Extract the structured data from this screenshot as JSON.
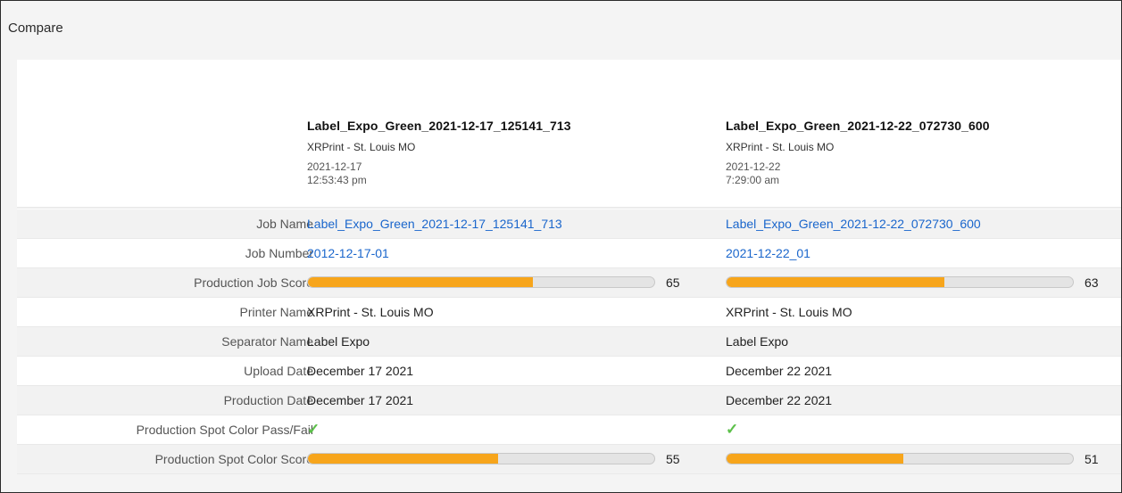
{
  "window": {
    "title": "Compare"
  },
  "jobs": [
    {
      "name": "Label_Expo_Green_2021-12-17_125141_713",
      "printer": "XRPrint - St. Louis MO",
      "date": "2021-12-17",
      "time": "12:53:43 pm"
    },
    {
      "name": "Label_Expo_Green_2021-12-22_072730_600",
      "printer": "XRPrint - St. Louis MO",
      "date": "2021-12-22",
      "time": "7:29:00 am"
    }
  ],
  "rows": {
    "job_name": {
      "label": "Job Name",
      "values": [
        "Label_Expo_Green_2021-12-17_125141_713",
        "Label_Expo_Green_2021-12-22_072730_600"
      ]
    },
    "job_number": {
      "label": "Job Number",
      "values": [
        "2012-12-17-01",
        "2021-12-22_01"
      ]
    },
    "production_job_score": {
      "label": "Production Job Score",
      "values": [
        65,
        63
      ]
    },
    "printer_name": {
      "label": "Printer Name",
      "values": [
        "XRPrint - St. Louis MO",
        "XRPrint - St. Louis MO"
      ]
    },
    "separator_name": {
      "label": "Separator Name",
      "values": [
        "Label Expo",
        "Label Expo"
      ]
    },
    "upload_date": {
      "label": "Upload Date",
      "values": [
        "December 17 2021",
        "December 22 2021"
      ]
    },
    "production_date": {
      "label": "Production Date",
      "values": [
        "December 17 2021",
        "December 22 2021"
      ]
    },
    "spot_pass_fail": {
      "label": "Production Spot Color Pass/Fail",
      "values": [
        "pass",
        "pass"
      ]
    },
    "spot_color_score": {
      "label": "Production Spot Color Score",
      "values": [
        55,
        51
      ]
    }
  },
  "icons": {
    "pass": "checkmark-icon"
  },
  "colors": {
    "bar_fill": "#f7a51b",
    "link": "#1a66cc",
    "pass": "#5cc04a"
  }
}
